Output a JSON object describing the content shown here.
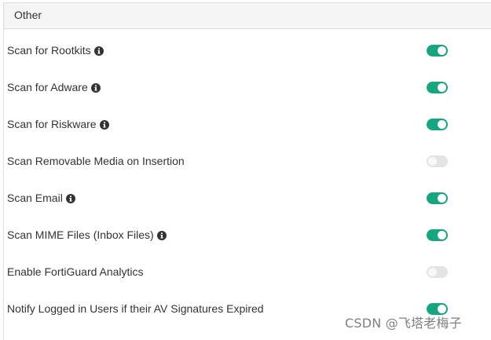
{
  "panel": {
    "title": "Other"
  },
  "settings": [
    {
      "label": "Scan for Rootkits",
      "info": true,
      "enabled": true
    },
    {
      "label": "Scan for Adware",
      "info": true,
      "enabled": true
    },
    {
      "label": "Scan for Riskware",
      "info": true,
      "enabled": true
    },
    {
      "label": "Scan Removable Media on Insertion",
      "info": false,
      "enabled": false
    },
    {
      "label": "Scan Email",
      "info": true,
      "enabled": true
    },
    {
      "label": "Scan MIME Files (Inbox Files)",
      "info": true,
      "enabled": true
    },
    {
      "label": "Enable FortiGuard Analytics",
      "info": false,
      "enabled": false
    },
    {
      "label": "Notify Logged in Users if their AV Signatures Expired",
      "info": false,
      "enabled": true
    }
  ],
  "icons": {
    "info": "info-circle-icon"
  },
  "colors": {
    "toggle_on": "#13a680",
    "toggle_off": "#e4e4e4"
  },
  "watermark": "CSDN @飞塔老梅子"
}
